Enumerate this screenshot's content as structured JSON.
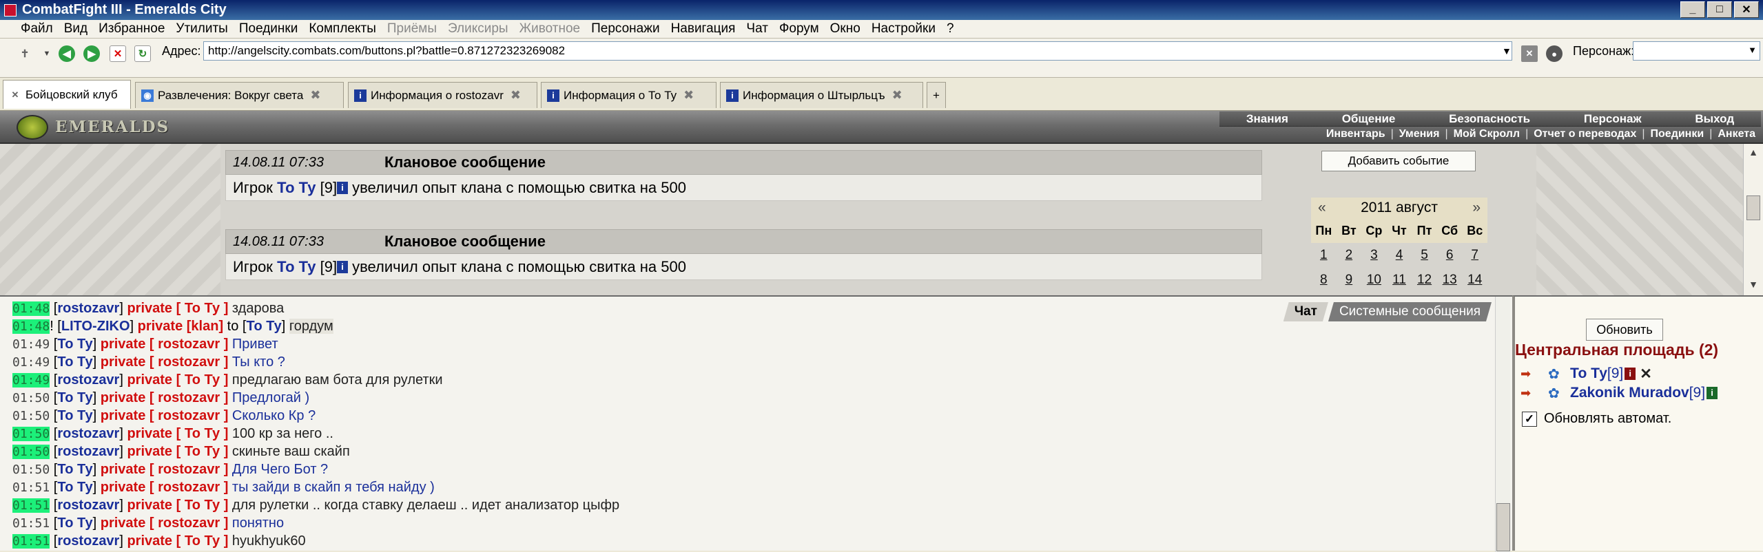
{
  "window": {
    "title": "CombatFight III - Emeralds City"
  },
  "menu": [
    "Файл",
    "Вид",
    "Избранное",
    "Утилиты",
    "Поединки",
    "Комплекты",
    "Приёмы",
    "Эликсиры",
    "Животное",
    "Персонажи",
    "Навигация",
    "Чат",
    "Форум",
    "Окно",
    "Настройки",
    "?"
  ],
  "menu_disabled": [
    "Приёмы",
    "Эликсиры",
    "Животное"
  ],
  "address": {
    "label": "Адрес:",
    "url": "http://angelscity.combats.com/buttons.pl?battle=0.871272323269082",
    "person_label": "Персонаж:"
  },
  "tabs": [
    {
      "label": "Бойцовский клуб",
      "active": true
    },
    {
      "label": "Развлечения: Вокруг света",
      "active": false
    },
    {
      "label": "Информация о rostozavr",
      "active": false
    },
    {
      "label": "Информация о То Ту",
      "active": false
    },
    {
      "label": "Информация о Штырльцъ",
      "active": false
    }
  ],
  "banner": {
    "logo": "EMERALDS",
    "top_nav": [
      "Знания",
      "Общение",
      "Безопасность",
      "Персонаж",
      "Выход"
    ],
    "sub_nav": [
      "Инвентарь",
      "Умения",
      "Мой Скролл",
      "Отчет о переводах",
      "Поединки",
      "Анкета"
    ]
  },
  "events": [
    {
      "date": "14.08.11 07:33",
      "title": "Клановое сообщение",
      "prefix": "Игрок",
      "player": "То Ту",
      "level": "[9]",
      "text": "увеличил опыт клана с помощью свитка на 500"
    },
    {
      "date": "14.08.11 07:33",
      "title": "Клановое сообщение",
      "prefix": "Игрок",
      "player": "То Ту",
      "level": "[9]",
      "text": "увеличил опыт клана с помощью свитка на 500"
    }
  ],
  "add_event_label": "Добавить событие",
  "calendar": {
    "prev": "«",
    "next": "»",
    "month": "2011 август",
    "weekdays": [
      "Пн",
      "Вт",
      "Ср",
      "Чт",
      "Пт",
      "Сб",
      "Вс"
    ],
    "days": [
      "1",
      "2",
      "3",
      "4",
      "5",
      "6",
      "7",
      "8",
      "9",
      "10",
      "11",
      "12",
      "13",
      "14"
    ]
  },
  "chat_tabs": {
    "chat": "Чат",
    "system": "Системные сообщения"
  },
  "chat": [
    {
      "time": "01:48",
      "hl": true,
      "from": "rostozavr",
      "priv": "private [ То Ту ]",
      "text": "здарова",
      "dark": true
    },
    {
      "time": "01:48",
      "hl": true,
      "mark": "!",
      "from": "LITO-ZIKO",
      "priv": "private [klan]",
      "to": "to",
      "to_nick": "То Ту",
      "text": "гордум",
      "dark": true,
      "me": true
    },
    {
      "time": "01:49",
      "hl": false,
      "from": "То Ту",
      "priv": "private [ rostozavr ]",
      "text": "Привет",
      "dark": false
    },
    {
      "time": "01:49",
      "hl": false,
      "from": "То Ту",
      "priv": "private [ rostozavr ]",
      "text": "Ты кто ?",
      "dark": false
    },
    {
      "time": "01:49",
      "hl": true,
      "from": "rostozavr",
      "priv": "private [ То Ту ]",
      "text": "предлагаю вам бота для рулетки",
      "dark": true
    },
    {
      "time": "01:50",
      "hl": false,
      "from": "То Ту",
      "priv": "private [ rostozavr ]",
      "text": "Предлогай )",
      "dark": false
    },
    {
      "time": "01:50",
      "hl": false,
      "from": "То Ту",
      "priv": "private [ rostozavr ]",
      "text": "Сколько Кр ?",
      "dark": false
    },
    {
      "time": "01:50",
      "hl": true,
      "from": "rostozavr",
      "priv": "private [ То Ту ]",
      "text": "100 кр за него ..",
      "dark": true
    },
    {
      "time": "01:50",
      "hl": true,
      "from": "rostozavr",
      "priv": "private [ То Ту ]",
      "text": "скиньте ваш скайп",
      "dark": true
    },
    {
      "time": "01:50",
      "hl": false,
      "from": "То Ту",
      "priv": "private [ rostozavr ]",
      "text": "Для Чего Бот ?",
      "dark": false
    },
    {
      "time": "01:51",
      "hl": false,
      "from": "То Ту",
      "priv": "private [ rostozavr ]",
      "text": "ты зайди в скайп я тебя найду )",
      "dark": false
    },
    {
      "time": "01:51",
      "hl": true,
      "from": "rostozavr",
      "priv": "private [ То Ту ]",
      "text": "для рулетки .. когда ставку делаеш .. идет анализатор цыфр",
      "dark": true
    },
    {
      "time": "01:51",
      "hl": false,
      "from": "То Ту",
      "priv": "private [ rostozavr ]",
      "text": "понятно",
      "dark": false
    },
    {
      "time": "01:51",
      "hl": true,
      "from": "rostozavr",
      "priv": "private [ То Ту ]",
      "text": "hyukhyuk60",
      "dark": true
    }
  ],
  "sidebar": {
    "refresh_label": "Обновить",
    "room": "Центральная площадь (2)",
    "users": [
      {
        "name": "То Ту",
        "level": "[9]"
      },
      {
        "name": "Zakonik Muradov",
        "level": "[9]"
      }
    ],
    "auto_label": "Обновлять автомат."
  }
}
